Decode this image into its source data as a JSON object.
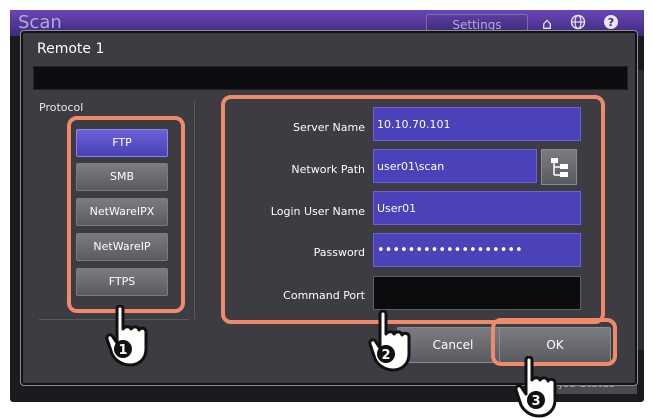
{
  "app": {
    "title": "Scan",
    "settings_label": "Settings",
    "job_status_label": "Job Status",
    "icons": [
      "home-icon",
      "globe-icon",
      "help-icon"
    ]
  },
  "dialog": {
    "title": "Remote 1",
    "header_field_value": ""
  },
  "protocol": {
    "label": "Protocol",
    "selected": "FTP",
    "options": [
      "FTP",
      "SMB",
      "NetWareIPX",
      "NetWareIP",
      "FTPS"
    ]
  },
  "fields": {
    "server_name": {
      "label": "Server Name",
      "value": "10.10.70.101"
    },
    "network_path": {
      "label": "Network Path",
      "value": "user01\\scan"
    },
    "login_user_name": {
      "label": "Login User Name",
      "value": "User01"
    },
    "password": {
      "label": "Password",
      "value": "•••••••••••••••••••"
    },
    "command_port": {
      "label": "Command Port",
      "value": ""
    }
  },
  "buttons": {
    "cancel": "Cancel",
    "ok": "OK"
  },
  "steps": [
    "1",
    "2",
    "3"
  ],
  "colors": {
    "accent": "#4b41b8",
    "highlight": "#ef8a6b",
    "dialog_bg": "#3c3c42",
    "titlebar": "#5a3ea0"
  }
}
